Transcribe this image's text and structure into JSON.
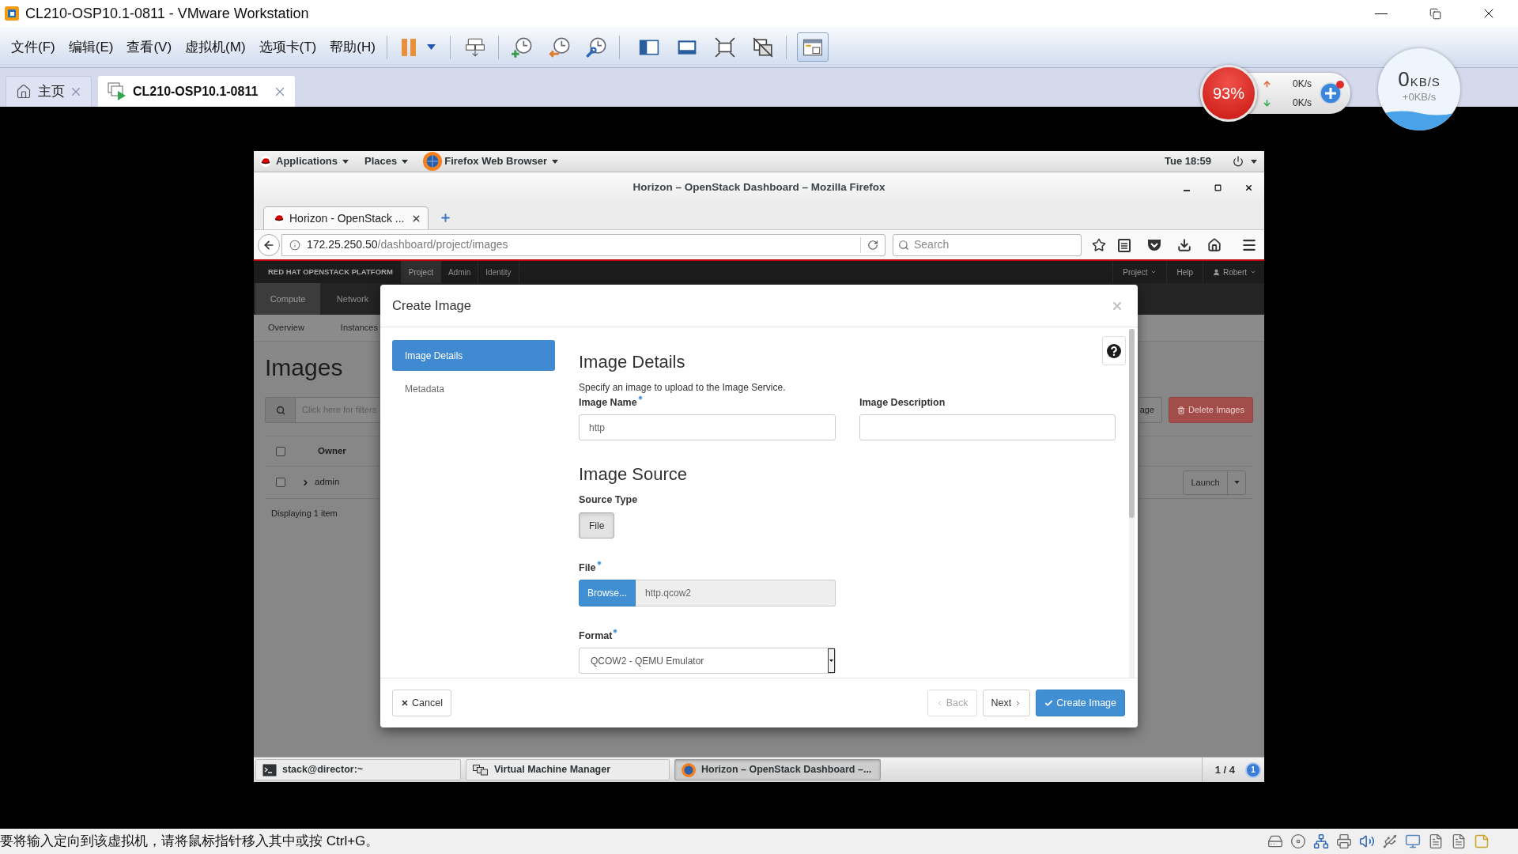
{
  "window": {
    "title": "CL210-OSP10.1-0811 - VMware Workstation"
  },
  "menu": [
    {
      "label": "文件(F)"
    },
    {
      "label": "编辑(E)"
    },
    {
      "label": "查看(V)"
    },
    {
      "label": "虚拟机(M)"
    },
    {
      "label": "选项卡(T)"
    },
    {
      "label": "帮助(H)"
    }
  ],
  "toolbar": [
    {
      "kind": "pause",
      "selected": false
    },
    {
      "kind": "send_keys",
      "selected": false
    },
    {
      "kind": "snapshot",
      "selected": false
    },
    {
      "kind": "revert",
      "selected": false
    },
    {
      "kind": "manager",
      "selected": false
    },
    {
      "kind": "sidebar",
      "selected": false
    },
    {
      "kind": "thumbnails",
      "selected": false
    },
    {
      "kind": "fullscreen",
      "selected": false
    },
    {
      "kind": "unity",
      "selected": false
    },
    {
      "kind": "console",
      "selected": true
    }
  ],
  "vm_tabs": [
    {
      "label": "主页",
      "kind": "home",
      "selected": false
    },
    {
      "label": "CL210-OSP10.1-0811",
      "kind": "vm",
      "selected": true
    }
  ],
  "speed_widget": {
    "usage": "93%",
    "upload": "0K/s",
    "download": "0K/s"
  },
  "speed_ball": {
    "value": "0",
    "unit": "KB/S",
    "delta": "+0KB/s"
  },
  "guest": {
    "top_panel": {
      "menus": [
        {
          "label": "Applications"
        },
        {
          "label": "Places"
        }
      ],
      "app": "Firefox Web Browser",
      "clock": "Tue 18:59"
    },
    "browser": {
      "title": "Horizon – OpenStack Dashboard – Mozilla Firefox",
      "tabs": [
        {
          "label": "Horizon - OpenStack ...",
          "selected": true
        }
      ],
      "url_host": "172.25.250.50",
      "url_path": "/dashboard/project/images",
      "search_placeholder": "Search"
    },
    "horizon": {
      "brand": "RED HAT OPENSTACK PLATFORM",
      "top_tabs": [
        {
          "label": "Project",
          "selected": true
        },
        {
          "label": "Admin",
          "selected": false
        },
        {
          "label": "Identity",
          "selected": false
        }
      ],
      "project_menu": "Project",
      "help": "Help",
      "user": "Robert",
      "nav": [
        {
          "label": "Compute",
          "selected": true
        },
        {
          "label": "Network",
          "selected": false
        }
      ],
      "subnav": [
        {
          "label": "Overview",
          "selected": false
        },
        {
          "label": "Instances",
          "selected": false
        }
      ],
      "title": "Images",
      "filter_placeholder": "Click here for filters",
      "actions": [
        {
          "label": "age",
          "kind": "default"
        },
        {
          "label": "Delete Images",
          "kind": "danger"
        }
      ],
      "table": {
        "select_all": {
          "checked": false
        },
        "columns": [
          {
            "label": "Owner"
          }
        ],
        "rows": [
          {
            "owner": "admin",
            "checked": false,
            "expanded": false,
            "action": "Launch"
          }
        ],
        "footer": "Displaying 1 item"
      }
    },
    "modal": {
      "title": "Create Image",
      "steps": [
        {
          "label": "Image Details",
          "selected": true
        },
        {
          "label": "Metadata",
          "selected": false
        }
      ],
      "heading": "Image Details",
      "description": "Specify an image to upload to the Image Service.",
      "image_name": {
        "label": "Image Name",
        "required": true,
        "value": "http"
      },
      "image_description": {
        "label": "Image Description",
        "required": false
      },
      "source_heading": "Image Source",
      "source_type": {
        "label": "Source Type",
        "options": [
          {
            "label": "File",
            "selected": true
          }
        ]
      },
      "file": {
        "label": "File",
        "required": true,
        "button": "Browse...",
        "value": "http.qcow2"
      },
      "format": {
        "label": "Format",
        "required": true,
        "value": "QCOW2 - QEMU Emulator"
      },
      "buttons": [
        {
          "label": "Cancel",
          "kind": "cancel",
          "disabled": false
        },
        {
          "label": "Back",
          "kind": "back",
          "disabled": true
        },
        {
          "label": "Next",
          "kind": "next",
          "disabled": false
        },
        {
          "label": "Create Image",
          "kind": "create",
          "disabled": false
        }
      ]
    },
    "taskbar": {
      "items": [
        {
          "label": "stack@director:~",
          "kind": "terminal",
          "selected": false
        },
        {
          "label": "Virtual Machine Manager",
          "kind": "vmm",
          "selected": false
        },
        {
          "label": "Horizon – OpenStack Dashboard –...",
          "kind": "browser",
          "selected": true
        }
      ],
      "workspace": "1 / 4",
      "notifications": "1"
    }
  },
  "status_bar": {
    "message": "要将输入定向到该虚拟机，请将鼠标指针移入其中或按 Ctrl+G。"
  }
}
